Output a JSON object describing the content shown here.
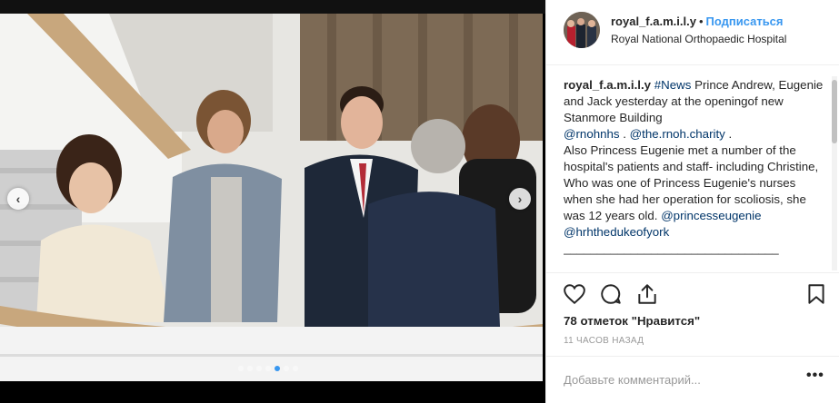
{
  "header": {
    "username": "royal_f.a.m.i.l.y",
    "separator": "•",
    "follow_label": "Подписаться",
    "location": "Royal National Orthopaedic Hospital"
  },
  "caption": {
    "username": "royal_f.a.m.i.l.y",
    "hashtag": "#News",
    "line1": " Prince Andrew, Eugenie and Jack yesterday at the openingof new Stanmore Building",
    "mention1": "@rnohnhs",
    "between": " . ",
    "mention2": "@the.rnoh.charity",
    "after": " .",
    "line2": "Also Princess Eugenie met a number of the hospital's patients and staff- including Christine, Who was one of Princess Eugenie's nurses when she had her operation for scoliosis, she was 12 years old.",
    "mention3": "@princesseugenie",
    "mention4": "@hrhthedukeofyork",
    "divider": "________________________________"
  },
  "actions": {
    "icons": [
      "heart-icon",
      "comment-icon",
      "share-icon",
      "bookmark-icon"
    ]
  },
  "likes": "78 отметок \"Нравится\"",
  "time": "11 ЧАСОВ НАЗАД",
  "comment": {
    "placeholder": "Добавьте комментарий...",
    "more": "•••"
  },
  "carousel": {
    "dots": 7,
    "active_index": 4
  },
  "colors": {
    "accent": "#3897f0",
    "link": "#003569",
    "text": "#262626",
    "muted": "#999999"
  }
}
